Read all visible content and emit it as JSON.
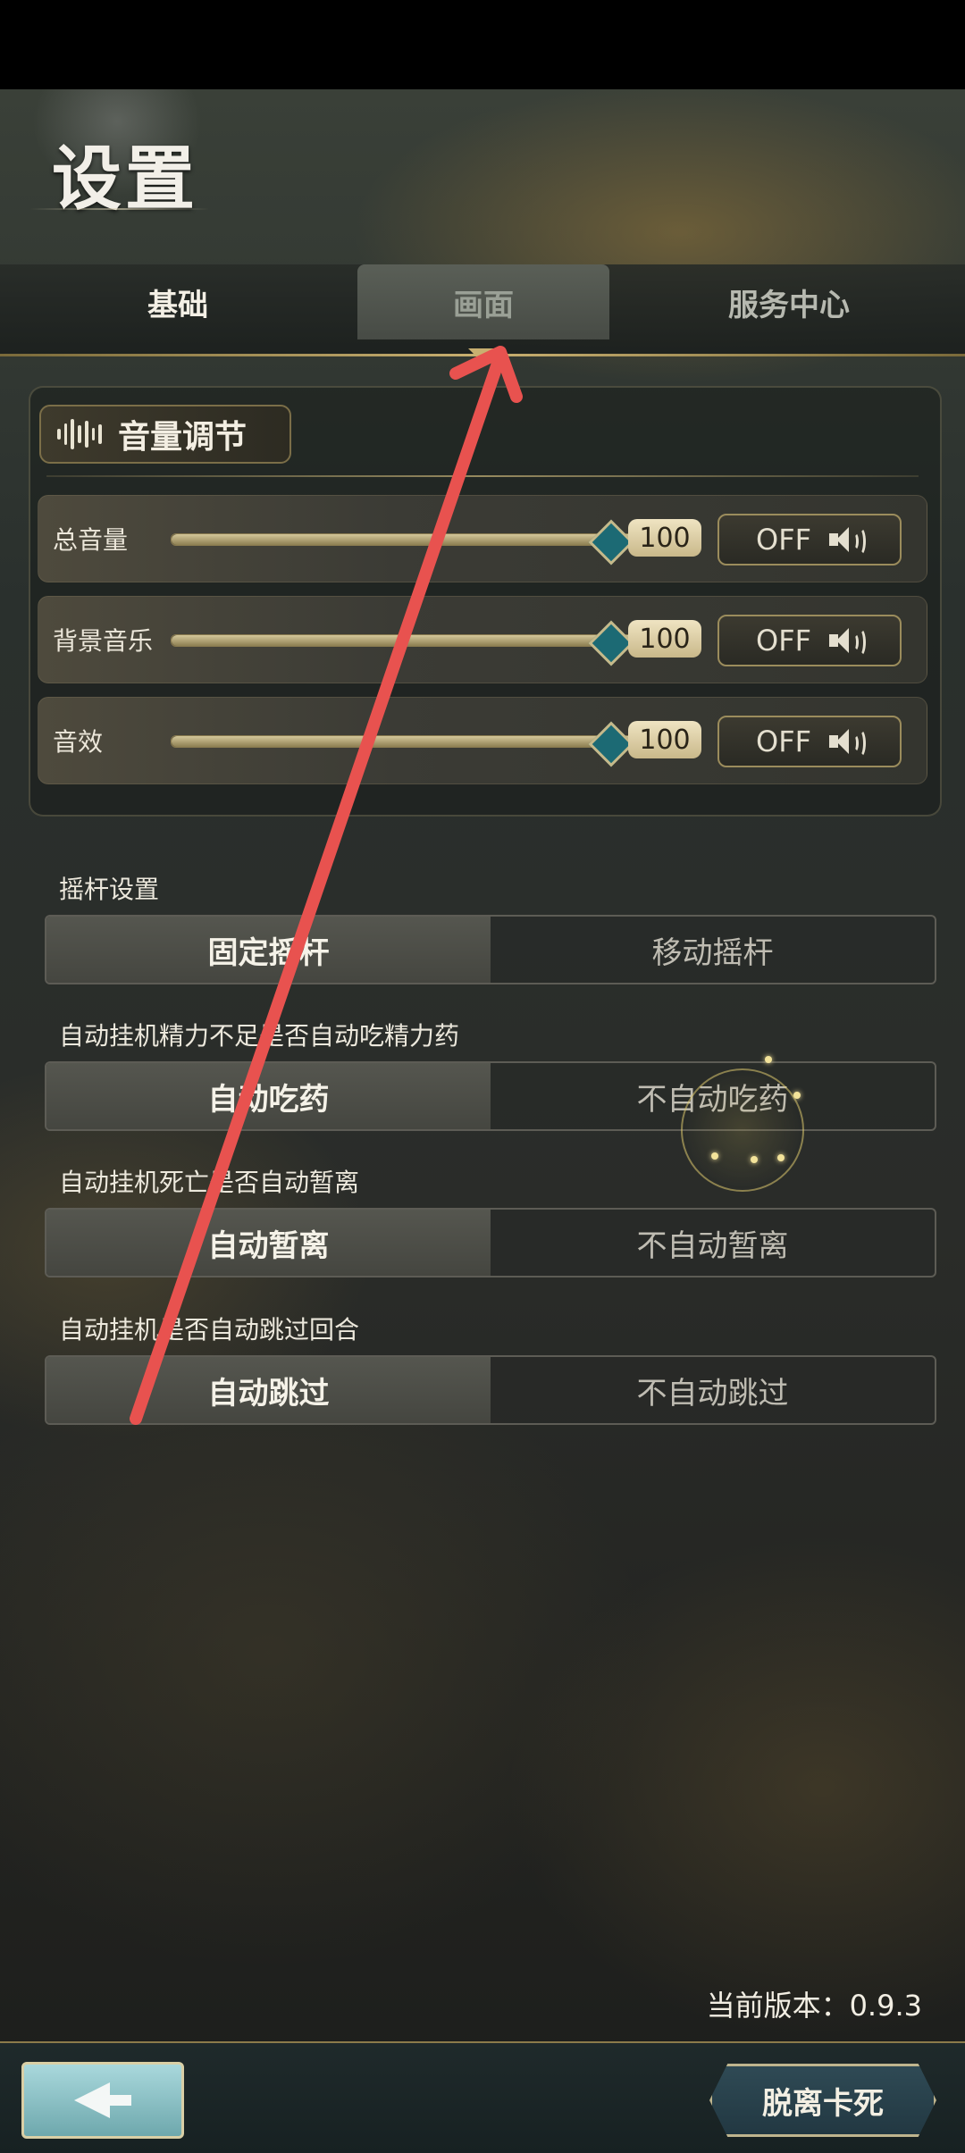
{
  "header": {
    "title": "设置"
  },
  "tabs": [
    {
      "label": "基础",
      "active": true
    },
    {
      "label": "画面",
      "active": false
    },
    {
      "label": "服务中心",
      "active": false
    }
  ],
  "volume": {
    "title": "音量调节",
    "rows": [
      {
        "label": "总音量",
        "value": "100",
        "level": 1.0,
        "mute_label": "OFF"
      },
      {
        "label": "背景音乐",
        "value": "100",
        "level": 1.0,
        "mute_label": "OFF"
      },
      {
        "label": "音效",
        "value": "100",
        "level": 1.0,
        "mute_label": "OFF"
      }
    ]
  },
  "settings": [
    {
      "label": "摇杆设置",
      "options": [
        "固定摇杆",
        "移动摇杆"
      ],
      "selected": 0
    },
    {
      "label": "自动挂机精力不足是否自动吃精力药",
      "options": [
        "自动吃药",
        "不自动吃药"
      ],
      "selected": 0
    },
    {
      "label": "自动挂机死亡是否自动暂离",
      "options": [
        "自动暂离",
        "不自动暂离"
      ],
      "selected": 0
    },
    {
      "label": "自动挂机是否自动跳过回合",
      "options": [
        "自动跳过",
        "不自动跳过"
      ],
      "selected": 0
    }
  ],
  "footer": {
    "version": "当前版本：0.9.3",
    "escape_label": "脱离卡死"
  },
  "colors": {
    "accent": "#c9b070",
    "annotation": "#e8524f"
  }
}
